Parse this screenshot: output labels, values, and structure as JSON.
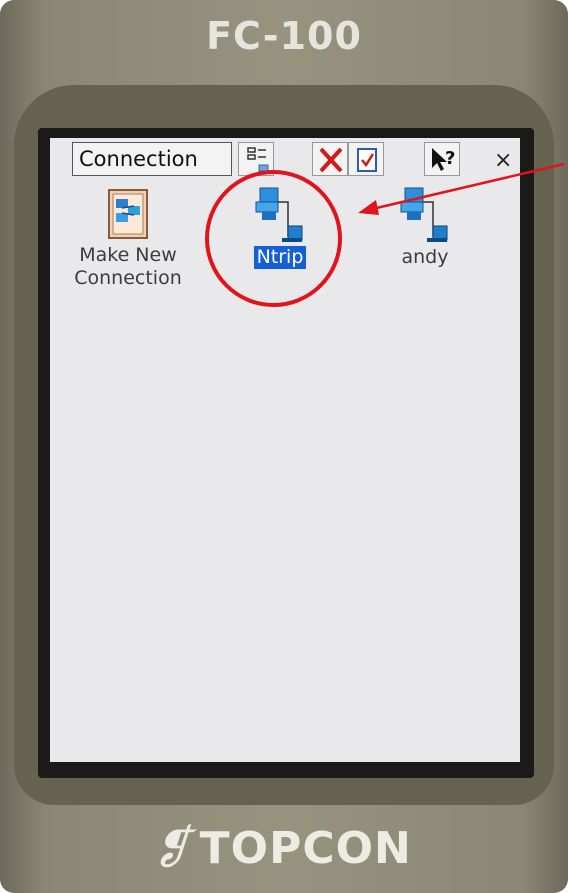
{
  "device": {
    "model": "FC-100",
    "brand": "TOPCON"
  },
  "window": {
    "title": "Connection"
  },
  "toolbar": {
    "buttons": [
      {
        "icon": "view-details-icon"
      },
      {
        "icon": "delete-icon"
      },
      {
        "icon": "properties-icon"
      },
      {
        "icon": "help-pointer-icon",
        "text": "?"
      },
      {
        "icon": "close-icon",
        "text": "×"
      }
    ]
  },
  "connections": [
    {
      "label_line1": "Make New",
      "label_line2": "Connection",
      "icon": "make-new-connection-icon",
      "selected": false
    },
    {
      "label_line1": "Ntrip",
      "icon": "network-connection-icon",
      "selected": true
    },
    {
      "label_line1": "andy",
      "icon": "network-connection-icon",
      "selected": false
    }
  ],
  "colors": {
    "annotation": "#e0141a",
    "selection": "#1560d6"
  }
}
